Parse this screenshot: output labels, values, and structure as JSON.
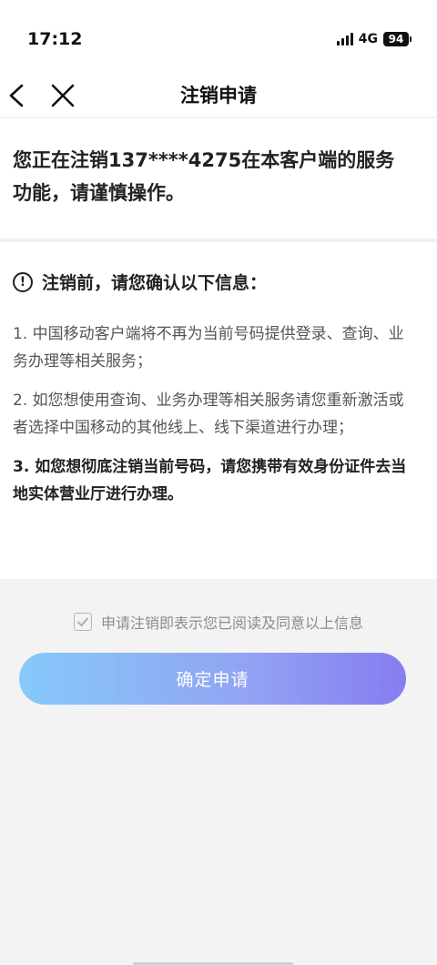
{
  "status_bar": {
    "time": "17:12",
    "network": "4G",
    "battery": "94"
  },
  "nav": {
    "title": "注销申请"
  },
  "header": {
    "text": "您正在注销137****4275在本客户端的服务功能，请谨慎操作。"
  },
  "info": {
    "heading": "注销前，请您确认以下信息：",
    "icon_glyph": "!",
    "items": [
      {
        "text": "1. 中国移动客户端将不再为当前号码提供登录、查询、业务办理等相关服务；"
      },
      {
        "text": "2. 如您想使用查询、业务办理等相关服务请您重新激活或者选择中国移动的其他线上、线下渠道进行办理；"
      },
      {
        "text": "3. 如您想彻底注销当前号码，请您携带有效身份证件去当地实体营业厅进行办理。"
      }
    ]
  },
  "agreement": {
    "label": "申请注销即表示您已阅读及同意以上信息",
    "checked": true
  },
  "confirm": {
    "label": "确定申请"
  },
  "colors": {
    "button_start": "#7cc6fb",
    "button_end": "#7d72f0",
    "page_bg": "#f3f3f3"
  }
}
